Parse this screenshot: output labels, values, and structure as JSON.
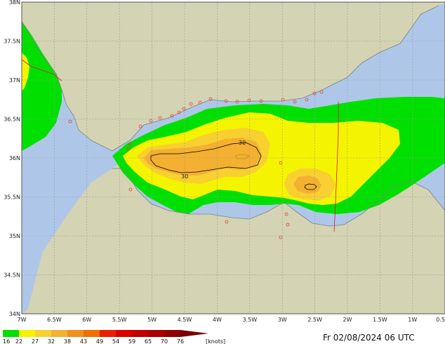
{
  "lat_labels": [
    "38N",
    "37.5N",
    "37N",
    "36.5N",
    "36N",
    "35.5N",
    "35N",
    "34.5N",
    "34N"
  ],
  "lon_labels": [
    "7W",
    "6.5W",
    "6W",
    "5.5W",
    "5W",
    "4.5W",
    "4W",
    "3.5W",
    "3W",
    "2.5W",
    "2W",
    "1.5W",
    "1W",
    "0.5"
  ],
  "contour_labels": [
    "30",
    "30"
  ],
  "legend": {
    "values": [
      "16",
      "22",
      "27",
      "32",
      "38",
      "43",
      "49",
      "54",
      "59",
      "65",
      "70",
      "76"
    ],
    "units": "[knots]",
    "colors": [
      "#00e000",
      "#f4f400",
      "#f8d030",
      "#f4b030",
      "#f09020",
      "#f07000",
      "#e82000",
      "#d80000",
      "#c00000",
      "#a80000",
      "#900000",
      "#780000"
    ]
  },
  "timestamp": "Fr 02/08/2024 06 UTC",
  "colors": {
    "land": "#d4d3b3",
    "sea": "#aec7e8",
    "grid": "#9a9a9a",
    "coast": "#7f7f7f",
    "border": "#e0103a",
    "green": "#00e000",
    "yellow": "#f4f400",
    "orange_light": "#f8d030",
    "orange": "#f4b030"
  }
}
